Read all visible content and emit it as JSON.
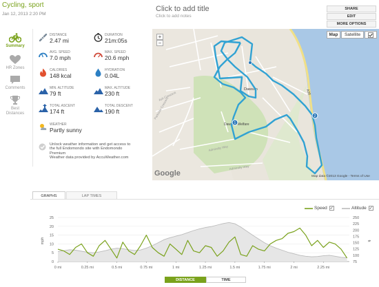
{
  "workout": {
    "title": "Cycling, sport",
    "date": "Jan 12, 2013 2:20 PM",
    "add_title": "Click to add title",
    "add_notes": "Click to add notes"
  },
  "actions": [
    "SHARE",
    "EDIT",
    "MORE OPTIONS"
  ],
  "side_nav": [
    {
      "label": "Summary",
      "active": true
    },
    {
      "label": "HR Zones",
      "active": false
    },
    {
      "label": "Comments",
      "active": false
    },
    {
      "label": "Best Distances",
      "active": false
    }
  ],
  "stats": [
    {
      "label": "DISTANCE",
      "value": "2.47 mi",
      "icon": "distance-icon"
    },
    {
      "label": "DURATION",
      "value": "21m:05s",
      "icon": "duration-icon"
    },
    {
      "label": "AVG. SPEED",
      "value": "7.0 mph",
      "icon": "avg-speed-icon"
    },
    {
      "label": "MAX. SPEED",
      "value": "20.6 mph",
      "icon": "max-speed-icon"
    },
    {
      "label": "CALORIES",
      "value": "148 kcal",
      "icon": "calories-icon"
    },
    {
      "label": "HYDRATION",
      "value": "0.04L",
      "icon": "hydration-icon"
    },
    {
      "label": "MIN. ALTITUDE",
      "value": "79 ft",
      "icon": "min-altitude-icon"
    },
    {
      "label": "MAX. ALTITUDE",
      "value": "230 ft",
      "icon": "max-altitude-icon"
    },
    {
      "label": "TOTAL ASCENT",
      "value": "174 ft",
      "icon": "ascent-icon"
    },
    {
      "label": "TOTAL DESCENT",
      "value": "190 ft",
      "icon": "descent-icon"
    }
  ],
  "weather": {
    "label": "WEATHER",
    "value": "Partly sunny"
  },
  "upsell": {
    "line1": "Unlock weather information and get access to",
    "line2": "the full Endomondo site with Endomondo",
    "line3": "Premium",
    "line4": "Weather data provided by AccuWeather.com"
  },
  "map": {
    "map_btn": "Map",
    "satellite_btn": "Satellite",
    "zoom_in": "+",
    "zoom_out": "−",
    "google": "Google",
    "attribution": "Map data ©2013 Google - Terms of Use",
    "labels": {
      "dawson": "Dawson",
      "dawson_welfare": "Dawson Welfare",
      "admiralty_way": "Admiralty Way",
      "admiralty_way_2": "Admiralty Way",
      "ash_crescent": "Ash Crescent",
      "parkside_crescent": "Parkside Crescent",
      "a38": "A38",
      "marker_1": "1",
      "marker_2": "2"
    }
  },
  "graph": {
    "tabs": [
      "GRAPHS",
      "LAP TIMES"
    ],
    "legend_speed": "Speed",
    "legend_altitude": "Altitude",
    "check": "✓",
    "toggle_distance": "DISTANCE",
    "toggle_time": "TIME",
    "ylabel_left": "mph",
    "ylabel_right": "ft"
  },
  "chart_data": {
    "type": "line",
    "xlabel": "",
    "x_ticks": [
      "0 mi",
      "0.25 mi",
      "0.5 mi",
      "0.75 mi",
      "1 mi",
      "1.25 mi",
      "1.5 mi",
      "1.75 mi",
      "2 mi",
      "2.25 mi"
    ],
    "xlim": [
      0,
      2.47
    ],
    "y_left": {
      "label": "mph",
      "ticks": [
        0,
        5,
        10,
        15,
        20,
        25
      ],
      "ylim": [
        0,
        25
      ]
    },
    "y_right": {
      "label": "ft",
      "ticks": [
        75,
        100,
        125,
        150,
        175,
        200,
        225,
        250
      ],
      "ylim": [
        75,
        250
      ]
    },
    "series": [
      {
        "name": "Speed",
        "axis": "left",
        "color": "#7aa21c",
        "x": [
          0,
          0.05,
          0.1,
          0.15,
          0.2,
          0.25,
          0.3,
          0.35,
          0.4,
          0.45,
          0.5,
          0.55,
          0.6,
          0.65,
          0.7,
          0.75,
          0.8,
          0.85,
          0.9,
          0.95,
          1.0,
          1.05,
          1.1,
          1.15,
          1.2,
          1.25,
          1.3,
          1.35,
          1.4,
          1.45,
          1.5,
          1.55,
          1.6,
          1.65,
          1.7,
          1.75,
          1.8,
          1.85,
          1.9,
          1.95,
          2.0,
          2.05,
          2.1,
          2.15,
          2.2,
          2.25,
          2.3,
          2.35,
          2.4,
          2.45
        ],
        "values": [
          7,
          6,
          4,
          8,
          10,
          5,
          3,
          9,
          12,
          7,
          2,
          11,
          6,
          4,
          9,
          15,
          8,
          5,
          3,
          10,
          7,
          4,
          12,
          6,
          5,
          9,
          8,
          3,
          6,
          11,
          14,
          4,
          3,
          9,
          7,
          6,
          10,
          12,
          13,
          16,
          17,
          19,
          15,
          9,
          12,
          8,
          11,
          10,
          7,
          2
        ]
      },
      {
        "name": "Altitude",
        "axis": "right",
        "color": "#bbbbbb",
        "x": [
          0,
          0.05,
          0.1,
          0.15,
          0.2,
          0.25,
          0.3,
          0.35,
          0.4,
          0.45,
          0.5,
          0.55,
          0.6,
          0.65,
          0.7,
          0.75,
          0.8,
          0.85,
          0.9,
          0.95,
          1.0,
          1.05,
          1.1,
          1.15,
          1.2,
          1.25,
          1.3,
          1.35,
          1.4,
          1.45,
          1.5,
          1.55,
          1.6,
          1.65,
          1.7,
          1.75,
          1.8,
          1.85,
          1.9,
          1.95,
          2.0,
          2.05,
          2.1,
          2.15,
          2.2,
          2.25,
          2.3,
          2.35,
          2.4,
          2.45
        ],
        "values": [
          115,
          118,
          122,
          120,
          116,
          112,
          110,
          113,
          118,
          124,
          128,
          126,
          122,
          119,
          121,
          128,
          138,
          150,
          162,
          170,
          176,
          182,
          190,
          198,
          205,
          210,
          214,
          220,
          226,
          230,
          225,
          212,
          196,
          180,
          165,
          150,
          138,
          128,
          120,
          112,
          106,
          100,
          96,
          94,
          95,
          98,
          100,
          96,
          92,
          90
        ]
      }
    ]
  }
}
